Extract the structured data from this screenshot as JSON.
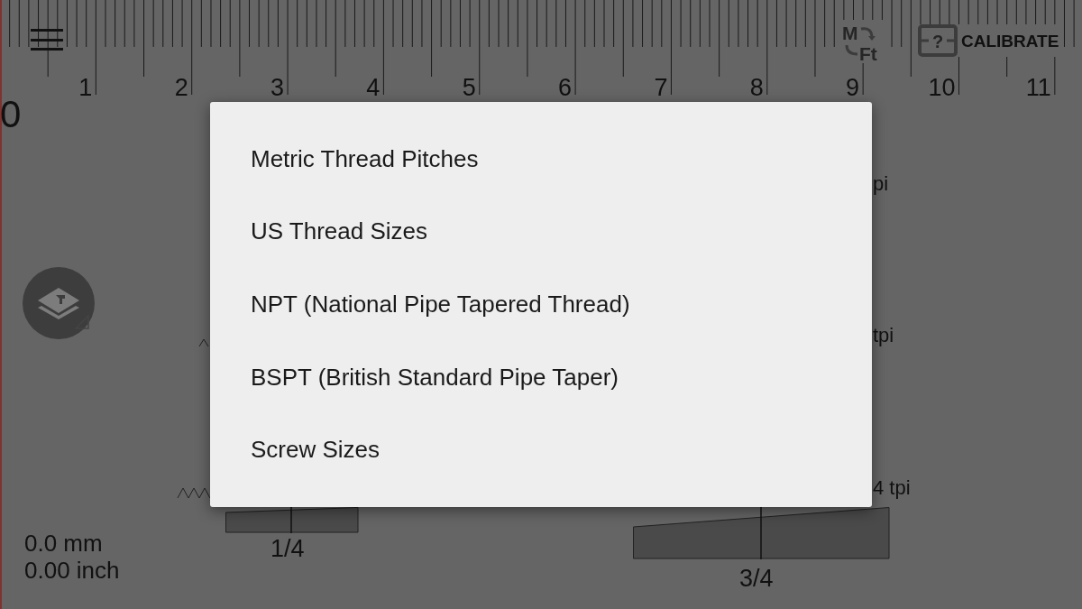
{
  "toolbar": {
    "unit_switch_top": "M",
    "unit_switch_bottom": "Ft",
    "calibrate_glyph": "?",
    "calibrate_label": "CALIBRATE"
  },
  "ruler": {
    "labels": [
      "1",
      "2",
      "3",
      "4",
      "5",
      "6",
      "7",
      "8",
      "9",
      "10",
      "11"
    ],
    "offset_reading": "0"
  },
  "thread_labels": [
    "pi",
    "tpi",
    "4 tpi"
  ],
  "gauges": [
    {
      "label": "1/4"
    },
    {
      "label": "3/4"
    }
  ],
  "readout": {
    "mm": "0.0 mm",
    "inch": "0.00 inch"
  },
  "menu": {
    "items": [
      "Metric Thread Pitches",
      "US Thread Sizes",
      "NPT (National Pipe Tapered Thread)",
      "BSPT (British Standard Pipe Taper)",
      "Screw Sizes"
    ]
  }
}
